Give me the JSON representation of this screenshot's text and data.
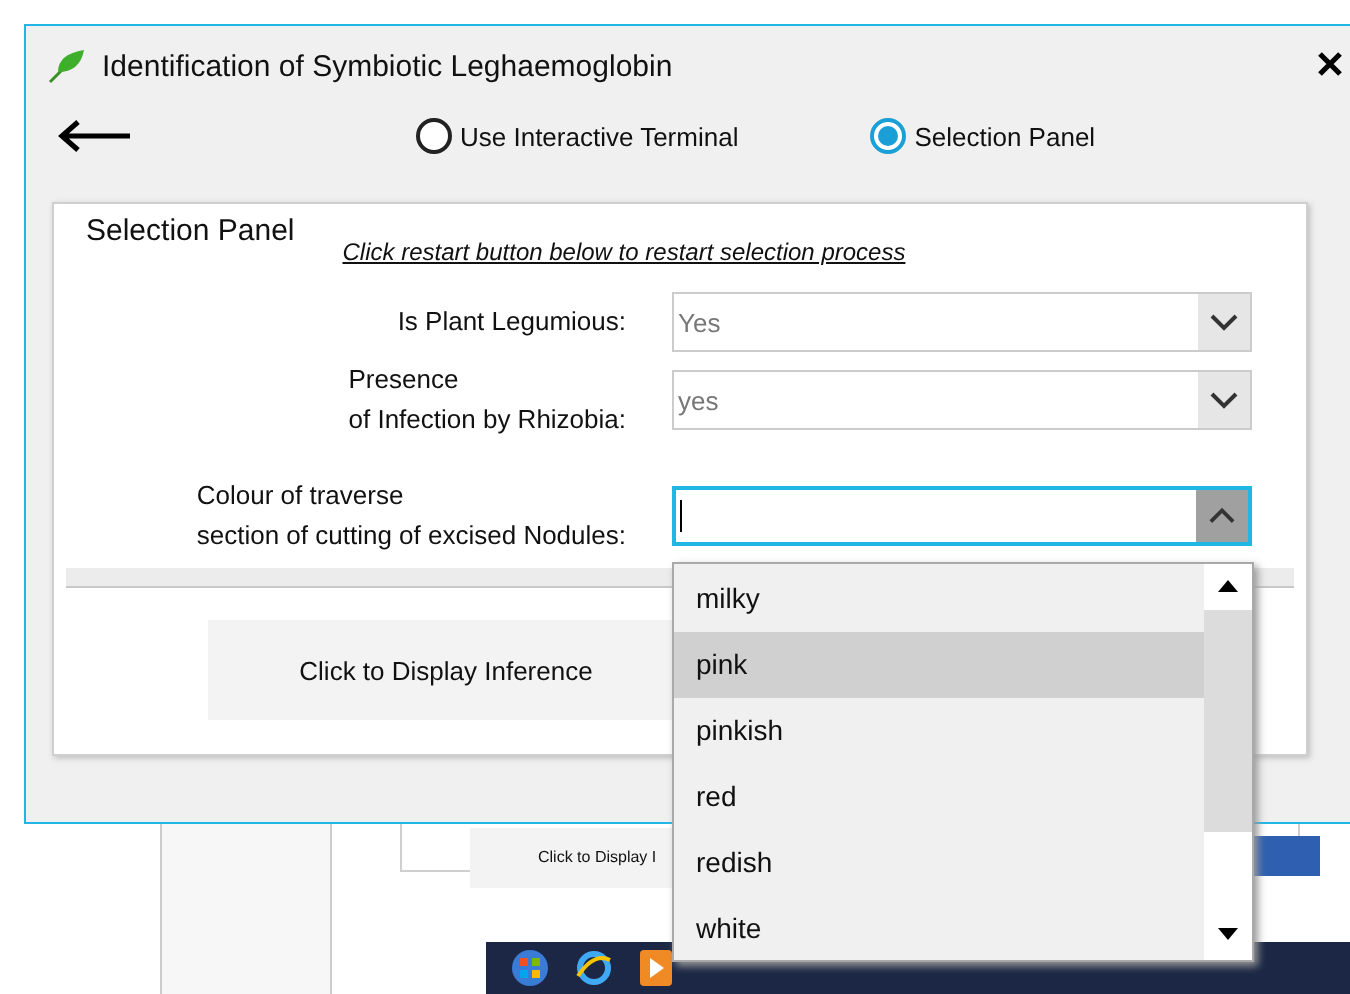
{
  "window": {
    "title": "Identification of Symbiotic Leghaemoglobin"
  },
  "mode_options": [
    {
      "label": "Use Interactive Terminal",
      "selected": false
    },
    {
      "label": "Selection Panel",
      "selected": true
    }
  ],
  "panel": {
    "title": "Selection Panel",
    "restart_link": "Click restart button below to restart selection process",
    "fields": [
      {
        "label_lines": [
          "Is Plant Legumious:"
        ],
        "value": "Yes",
        "open": false
      },
      {
        "label_lines": [
          "Presence",
          "of Infection by Rhizobia:"
        ],
        "value": "yes",
        "open": false
      },
      {
        "label_lines": [
          "Colour of traverse",
          "section of cutting of excised Nodules:"
        ],
        "open": true
      }
    ],
    "button": "Click to Display Inference"
  },
  "dropdown": {
    "options": [
      {
        "label": "milky",
        "selected": false
      },
      {
        "label": "pink",
        "selected": true
      },
      {
        "label": "pinkish",
        "selected": false
      },
      {
        "label": "red",
        "selected": false
      },
      {
        "label": "redish",
        "selected": false
      },
      {
        "label": "white",
        "selected": false
      }
    ]
  },
  "background_window": {
    "button": "Click to Display I"
  }
}
